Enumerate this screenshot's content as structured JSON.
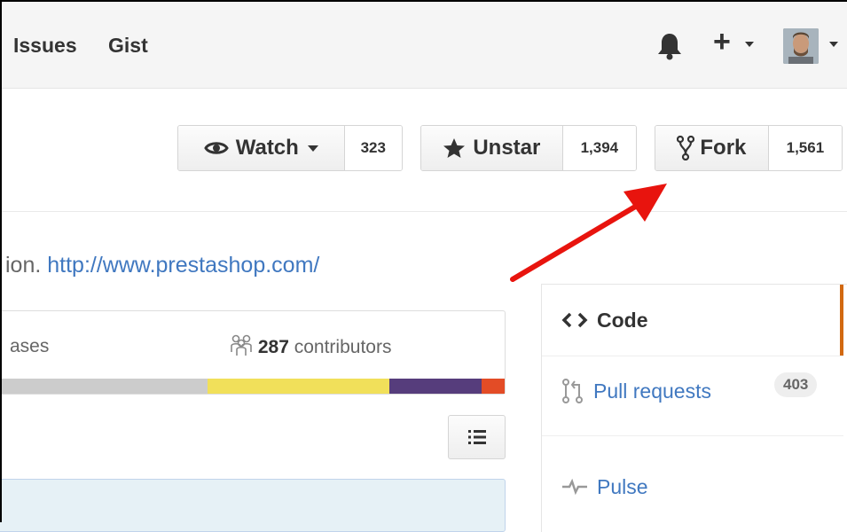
{
  "header": {
    "nav": [
      {
        "label": "Issues"
      },
      {
        "label": "Gist"
      }
    ],
    "icons": {
      "notifications": "bell-icon",
      "create": "plus-icon",
      "user": "avatar"
    }
  },
  "actions": {
    "watch": {
      "label": "Watch",
      "count": "323"
    },
    "star": {
      "label": "Unstar",
      "count": "1,394"
    },
    "fork": {
      "label": "Fork",
      "count": "1,561"
    }
  },
  "repo": {
    "description_tail": "ion.",
    "url": "http://www.prestashop.com/"
  },
  "summary": {
    "releases_label": "ases",
    "contributors_count": "287",
    "contributors_label": "contributors",
    "language_colors": [
      "#cccccc",
      "#f1e05a",
      "#563d7c",
      "#e34c26"
    ]
  },
  "sidebar": {
    "items": [
      {
        "label": "Code",
        "icon": "code-icon",
        "active": true
      },
      {
        "label": "Pull requests",
        "icon": "pull-request-icon",
        "count": "403"
      },
      {
        "label": "Pulse",
        "icon": "pulse-icon"
      }
    ]
  },
  "colors": {
    "link": "#4078c0",
    "active_tab": "#d26911",
    "arrow": "#e8140e"
  }
}
